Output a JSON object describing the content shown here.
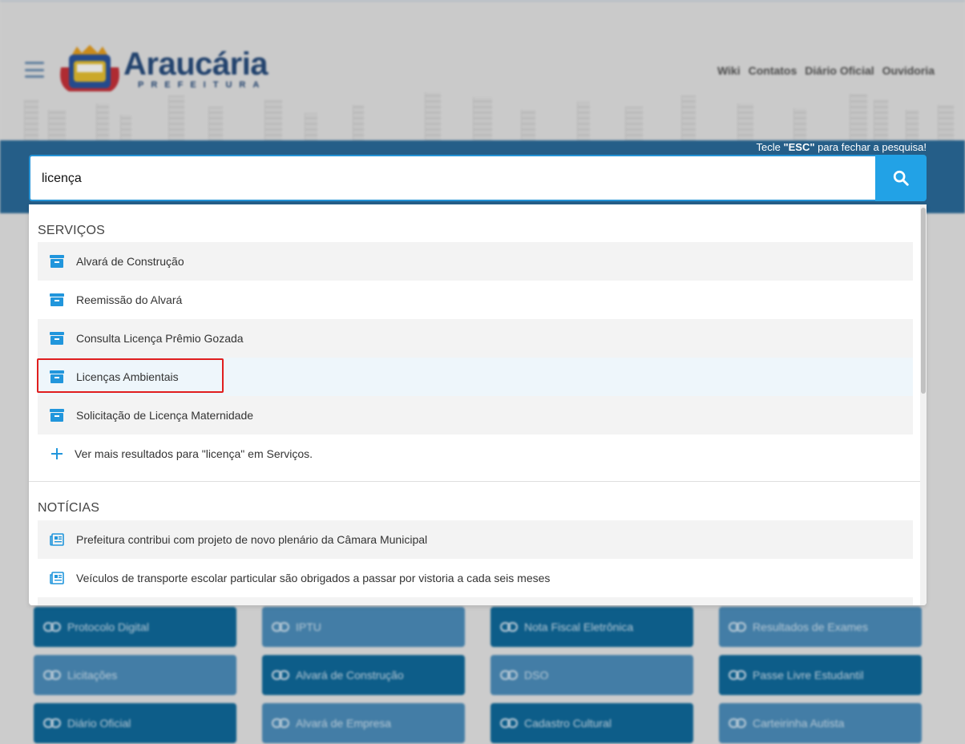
{
  "header": {
    "logo_name": "Araucária",
    "logo_sub": "PREFEITURA",
    "links": [
      "Wiki",
      "Contatos",
      "Diário Oficial",
      "Ouvidoria"
    ]
  },
  "search": {
    "esc_prefix": "Tecle ",
    "esc_key": "\"ESC\"",
    "esc_suffix": " para fechar a pesquisa!",
    "value": "licença",
    "button_icon": "search-icon"
  },
  "results": {
    "services": {
      "title": "SERVIÇOS",
      "items": [
        {
          "label": "Alvará de Construção",
          "icon": "box-icon"
        },
        {
          "label": "Reemissão do Alvará",
          "icon": "box-icon"
        },
        {
          "label": "Consulta Licença Prêmio Gozada",
          "icon": "box-icon"
        },
        {
          "label": "Licenças Ambientais",
          "icon": "box-icon"
        },
        {
          "label": "Solicitação de Licença Maternidade",
          "icon": "box-icon"
        }
      ],
      "more": "Ver mais resultados para \"licença\" em Serviços."
    },
    "news": {
      "title": "NOTÍCIAS",
      "items": [
        {
          "label": "Prefeitura contribui com projeto de novo plenário da Câmara Municipal",
          "icon": "newspaper-icon"
        },
        {
          "label": "Veículos de transporte escolar particular são obrigados a passar por vistoria a cada seis meses",
          "icon": "newspaper-icon"
        }
      ]
    }
  },
  "shortcuts": [
    {
      "label": "Protocolo Digital",
      "tone": "dark"
    },
    {
      "label": "IPTU",
      "tone": "light"
    },
    {
      "label": "Nota Fiscal Eletrônica",
      "tone": "dark"
    },
    {
      "label": "Resultados de Exames",
      "tone": "light"
    },
    {
      "label": "Licitações",
      "tone": "light"
    },
    {
      "label": "Alvará de Construção",
      "tone": "dark"
    },
    {
      "label": "DSO",
      "tone": "light"
    },
    {
      "label": "Passe Livre Estudantil",
      "tone": "dark"
    },
    {
      "label": "Diário Oficial",
      "tone": "dark"
    },
    {
      "label": "Alvará de Empresa",
      "tone": "light"
    },
    {
      "label": "Cadastro Cultural",
      "tone": "dark"
    },
    {
      "label": "Carteirinha Autista",
      "tone": "light"
    }
  ],
  "colors": {
    "accent": "#22a2e6",
    "brand": "#274c7d",
    "highlight_border": "#e01e1e",
    "band": "#2b6c9b"
  }
}
